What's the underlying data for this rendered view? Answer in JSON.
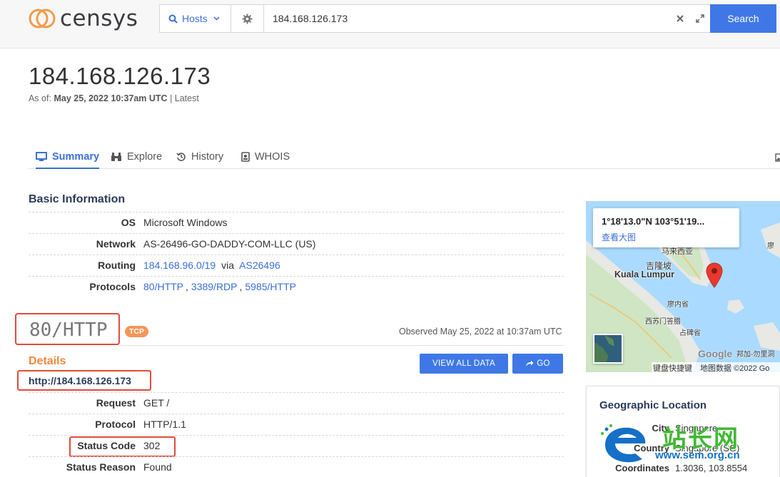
{
  "header": {
    "logo_text": "censys",
    "search_type": "Hosts",
    "query": "184.168.126.173",
    "search_label": "Search"
  },
  "host": {
    "ip": "184.168.126.173",
    "as_of_label": "As of:",
    "as_of_date": "May 25, 2022 10:37am UTC",
    "as_of_suffix": "| Latest"
  },
  "tabs": [
    {
      "label": "Summary",
      "active": true
    },
    {
      "label": "Explore",
      "active": false
    },
    {
      "label": "History",
      "active": false
    },
    {
      "label": "WHOIS",
      "active": false
    }
  ],
  "basic_info": {
    "title": "Basic Information",
    "os_label": "OS",
    "os_value": "Microsoft Windows",
    "network_label": "Network",
    "network_value": "AS-26496-GO-DADDY-COM-LLC (US)",
    "routing_label": "Routing",
    "routing_prefix": "184.168.96.0/19",
    "routing_via": "via",
    "routing_asn": "AS26496",
    "protocols_label": "Protocols",
    "protocols": [
      "80/HTTP",
      "3389/RDP",
      "5985/HTTP"
    ],
    "protocol_sep": ","
  },
  "service": {
    "name": "80/HTTP",
    "transport": "TCP",
    "observed": "Observed May 25, 2022 at 10:37am UTC",
    "details_title": "Details",
    "view_all_label": "VIEW ALL DATA",
    "go_label": "GO",
    "url": "http://184.168.126.173",
    "request_label": "Request",
    "request_value": "GET /",
    "protocol_label": "Protocol",
    "protocol_value": "HTTP/1.1",
    "status_code_label": "Status Code",
    "status_code_value": "302",
    "status_reason_label": "Status Reason",
    "status_reason_value": "Found"
  },
  "map": {
    "popup_coords": "1°18'13.0\"N 103°51'19...",
    "popup_link": "查看大图",
    "labels": {
      "malaysia": "马来西亚",
      "kl_cn": "吉隆坡",
      "kl_en": "Kuala Lumpur",
      "liao1": "廖内省",
      "xisu": "西苏门答腊",
      "zhanbei": "占碑省",
      "liao2": "廖",
      "bangka": "邦加-勿里洞"
    },
    "google": "Google",
    "footer_shortcuts": "键盘快捷键",
    "footer_data": "地图数据 ©2022 Go"
  },
  "geo": {
    "title": "Geographic Location",
    "city_label": "City",
    "city_value": "Singapore",
    "country_label": "Country",
    "country_value": "Singapore (SG)",
    "coords_label": "Coordinates",
    "coords_value": "1.3036, 103.8554"
  },
  "watermark": {
    "cn": "站长网",
    "url": "www.sem.org.cn"
  },
  "colors": {
    "accent": "#3f78e6",
    "link": "#3b6fd6",
    "details_orange": "#f0883e",
    "tcp_badge": "#f5955a",
    "highlight_red": "#e24a3b"
  }
}
